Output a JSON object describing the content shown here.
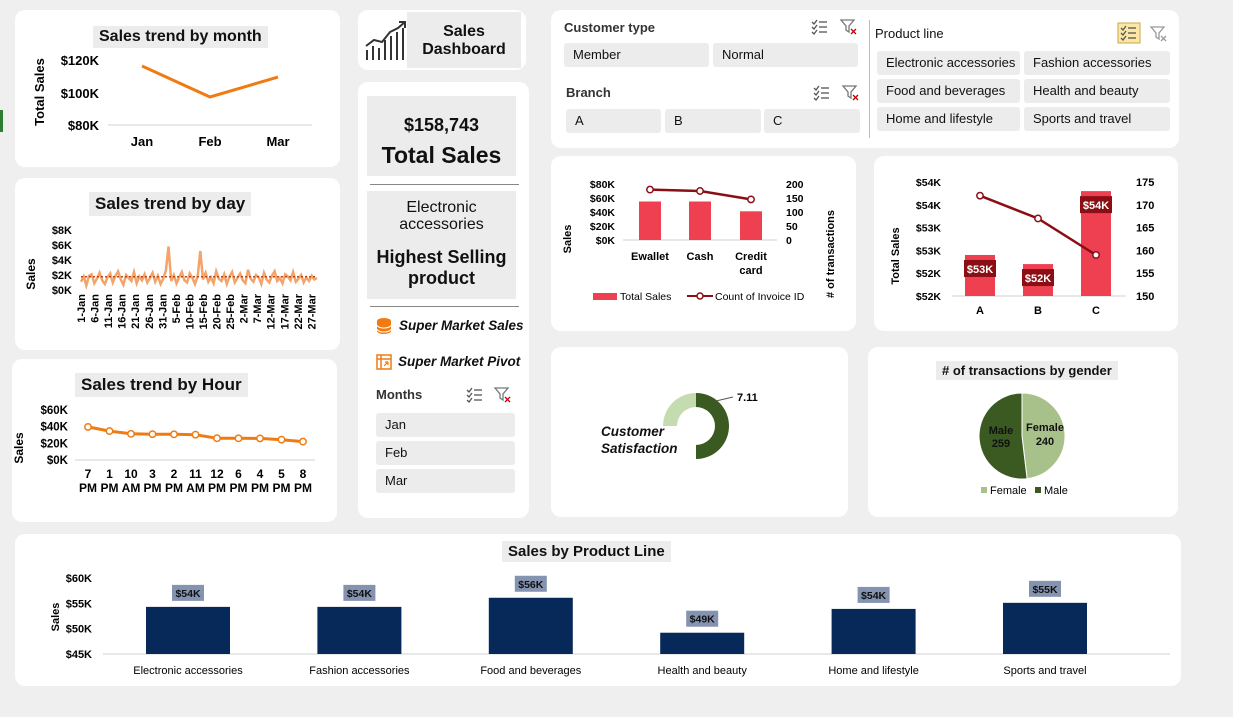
{
  "colors": {
    "orange": "#f07b12",
    "orange_light": "#f4a46b",
    "red": "#ee4050",
    "dark_red": "#8b0e14",
    "navy": "#06295a",
    "dark_green": "#3a5a22",
    "light_green": "#a8c08a",
    "data_label_bg": "#8393b0"
  },
  "month_chart": {
    "title": "Sales trend by month",
    "ylabel": "Total Sales",
    "yticks": [
      "$120K",
      "$100K",
      "$80K"
    ],
    "categories": [
      "Jan",
      "Feb",
      "Mar"
    ]
  },
  "day_chart": {
    "title": "Sales trend by day",
    "ylabel": "Sales",
    "yticks": [
      "$8K",
      "$6K",
      "$4K",
      "$2K",
      "$0K"
    ],
    "xticks": [
      "1-Jan",
      "6-Jan",
      "11-Jan",
      "16-Jan",
      "21-Jan",
      "26-Jan",
      "31-Jan",
      "5-Feb",
      "10-Feb",
      "15-Feb",
      "20-Feb",
      "25-Feb",
      "2-Mar",
      "7-Mar",
      "12-Mar",
      "17-Mar",
      "22-Mar",
      "27-Mar"
    ]
  },
  "hour_chart": {
    "title": "Sales trend by Hour",
    "ylabel": "Sales",
    "yticks": [
      "$60K",
      "$40K",
      "$20K",
      "$0K"
    ],
    "categories": [
      [
        "7",
        "PM"
      ],
      [
        "1",
        "PM"
      ],
      [
        "10",
        "AM"
      ],
      [
        "3",
        "PM"
      ],
      [
        "2",
        "PM"
      ],
      [
        "11",
        "AM"
      ],
      [
        "12",
        "PM"
      ],
      [
        "6",
        "PM"
      ],
      [
        "4",
        "PM"
      ],
      [
        "5",
        "PM"
      ],
      [
        "8",
        "PM"
      ]
    ]
  },
  "header": {
    "title_line1": "Sales",
    "title_line2": "Dashboard",
    "icon": "growth-chart-icon"
  },
  "kpi": {
    "total_sales_value": "$158,743",
    "total_sales_label": "Total Sales",
    "top_product_line1": "Electronic",
    "top_product_line2": "accessories",
    "top_product_label_line1": "Highest Selling",
    "top_product_label_line2": "product"
  },
  "links": [
    {
      "label": "Super Market Sales",
      "icon": "database-icon"
    },
    {
      "label": "Super Market Pivot",
      "icon": "pivot-table-icon"
    }
  ],
  "slicers": {
    "months": {
      "title": "Months",
      "items": [
        "Jan",
        "Feb",
        "Mar"
      ]
    },
    "customer_type": {
      "title": "Customer type",
      "items": [
        "Member",
        "Normal"
      ]
    },
    "branch": {
      "title": "Branch",
      "items": [
        "A",
        "B",
        "C"
      ]
    },
    "product_line": {
      "title": "Product line",
      "items": [
        "Electronic accessories",
        "Fashion accessories",
        "Food and beverages",
        "Health and beauty",
        "Home and lifestyle",
        "Sports and travel"
      ]
    }
  },
  "payment_chart": {
    "ylabel_left": "Sales",
    "ylabel_right": "# of transactions",
    "yticks_left": [
      "$80K",
      "$60K",
      "$40K",
      "$20K",
      "$0K"
    ],
    "yticks_right": [
      "200",
      "150",
      "100",
      "50",
      "0"
    ],
    "categories": [
      [
        "Ewallet"
      ],
      [
        "Cash"
      ],
      [
        "Credit",
        "card"
      ]
    ],
    "legend": [
      "Total Sales",
      "Count of Invoice ID"
    ]
  },
  "branch_chart": {
    "ylabel": "Total Sales",
    "yticks_left": [
      "$54K",
      "$54K",
      "$53K",
      "$53K",
      "$52K",
      "$52K"
    ],
    "yticks_right": [
      "175",
      "170",
      "165",
      "160",
      "155",
      "150"
    ],
    "categories": [
      "A",
      "B",
      "C"
    ],
    "data_labels": [
      "$53K",
      "$52K",
      "$54K"
    ]
  },
  "satisfaction": {
    "label_line1": "Customer",
    "label_line2": "Satisfaction",
    "value_label": "7.11"
  },
  "gender_chart": {
    "title": "# of transactions by gender",
    "legend": [
      "Female",
      "Male"
    ],
    "slice_labels": [
      [
        "Male",
        "259"
      ],
      [
        "Female",
        "240"
      ]
    ]
  },
  "product_chart": {
    "title": "Sales by Product Line",
    "ylabel": "Sales",
    "yticks": [
      "$60K",
      "$55K",
      "$50K",
      "$45K"
    ],
    "data_labels": [
      "$54K",
      "$54K",
      "$56K",
      "$49K",
      "$54K",
      "$55K"
    ]
  },
  "chart_data": [
    {
      "type": "line",
      "title": "Sales trend by month",
      "ylabel": "Total Sales",
      "categories": [
        "Jan",
        "Feb",
        "Mar"
      ],
      "values": [
        116300,
        97200,
        109500
      ],
      "ylim": [
        80000,
        120000
      ]
    },
    {
      "type": "line",
      "title": "Sales trend by day",
      "ylabel": "Sales",
      "x_start": "1-Jan",
      "x_end": "30-Mar",
      "values": [
        1100,
        1800,
        600,
        1900,
        2100,
        900,
        1500,
        2300,
        1300,
        800,
        1700,
        2200,
        1000,
        1900,
        2500,
        1400,
        700,
        2000,
        1600,
        1200,
        2400,
        900,
        1800,
        1300,
        2100,
        1000,
        1600,
        2300,
        1100,
        1900,
        800,
        1500,
        2600,
        5800,
        1200,
        2000,
        900,
        1700,
        2400,
        1300,
        1000,
        2200,
        1600,
        800,
        1900,
        5200,
        1400,
        2300,
        1100,
        1700,
        900,
        2500,
        1500,
        1200,
        2100,
        800,
        1800,
        2400,
        1000,
        1600,
        2200,
        1300,
        900,
        2700,
        1500,
        1100,
        2000,
        1700,
        800,
        2300,
        1400,
        1000,
        1900,
        2500,
        1200,
        1600,
        900,
        2100,
        1800,
        1300,
        2400,
        1100,
        1500,
        2000,
        1000,
        1700,
        1200,
        1900,
        1400,
        1600
      ],
      "average": 1764,
      "ylim": [
        0,
        8000
      ]
    },
    {
      "type": "line",
      "title": "Sales trend by Hour",
      "ylabel": "Sales",
      "categories": [
        "7 PM",
        "1 PM",
        "10 AM",
        "3 PM",
        "2 PM",
        "11 AM",
        "12 PM",
        "6 PM",
        "4 PM",
        "5 PM",
        "8 PM"
      ],
      "values": [
        39700,
        34700,
        31400,
        31000,
        30800,
        30400,
        26100,
        26000,
        25900,
        24400,
        22100
      ],
      "ylim": [
        0,
        60000
      ]
    },
    {
      "type": "bar",
      "categories": [
        "Ewallet",
        "Cash",
        "Credit card"
      ],
      "series": [
        {
          "name": "Total Sales",
          "values": [
            55000,
            55000,
            41000
          ],
          "axis": "left"
        },
        {
          "name": "Count of Invoice ID",
          "values": [
            180,
            175,
            145
          ],
          "axis": "right",
          "type": "line"
        }
      ],
      "ylabel": "Sales",
      "ylabel_right": "# of transactions",
      "ylim": [
        0,
        80000
      ],
      "ylim_right": [
        0,
        200
      ]
    },
    {
      "type": "bar",
      "categories": [
        "A",
        "B",
        "C"
      ],
      "series": [
        {
          "values": [
            52900,
            52700,
            54300
          ],
          "axis": "left"
        },
        {
          "values": [
            172,
            167,
            159
          ],
          "axis": "right",
          "type": "line"
        }
      ],
      "ylabel": "Total Sales",
      "ylim": [
        52000,
        54500
      ],
      "ylim_right": [
        150,
        175
      ]
    },
    {
      "type": "pie",
      "title": "Customer Satisfaction",
      "values": [
        7.11
      ],
      "max": 10
    },
    {
      "type": "pie",
      "title": "# of transactions by gender",
      "categories": [
        "Female",
        "Male"
      ],
      "values": [
        240,
        259
      ]
    },
    {
      "type": "bar",
      "title": "Sales by Product Line",
      "ylabel": "Sales",
      "categories": [
        "Electronic accessories",
        "Fashion accessories",
        "Food and beverages",
        "Health and beauty",
        "Home and lifestyle",
        "Sports and travel"
      ],
      "values": [
        54300,
        54300,
        56100,
        49200,
        53900,
        55100
      ],
      "ylim": [
        45000,
        60000
      ]
    }
  ]
}
